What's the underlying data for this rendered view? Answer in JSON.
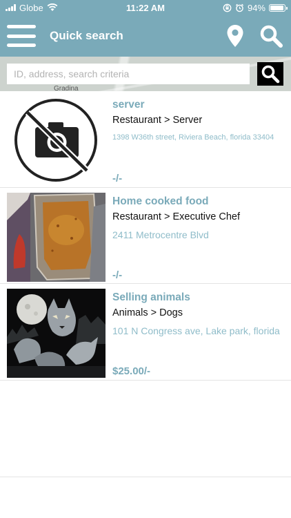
{
  "status_bar": {
    "carrier": "Globe",
    "time": "11:22 AM",
    "battery": "94%",
    "battery_level": 0.94,
    "icons": [
      "signal-icon",
      "wifi-icon",
      "orientation-lock-icon",
      "alarm-icon",
      "battery-icon"
    ]
  },
  "header": {
    "title": "Quick search",
    "icons": [
      "menu-icon",
      "map-pin-icon",
      "search-icon"
    ]
  },
  "search": {
    "placeholder": "ID, address, search criteria",
    "value": "",
    "map_label": "Gradina"
  },
  "listings": [
    {
      "title": "server",
      "category": "Restaurant > Server",
      "address": "1398 W36th street, Riviera Beach, florida 33404",
      "price": "-/-",
      "image": "no-photo-icon"
    },
    {
      "title": "Home cooked food",
      "category": "Restaurant > Executive Chef",
      "address": "2411 Metrocentre Blvd",
      "price": "-/-",
      "image": "food-dish-photo"
    },
    {
      "title": "Selling animals",
      "category": "Animals > Dogs",
      "address": "101 N Congress ave, Lake park, florida",
      "price": "$25.00/-",
      "image": "wolves-moon-photo"
    }
  ],
  "colors": {
    "accent": "#7aaab9",
    "address": "#8fbcc9",
    "divider": "#e3e3e3"
  }
}
